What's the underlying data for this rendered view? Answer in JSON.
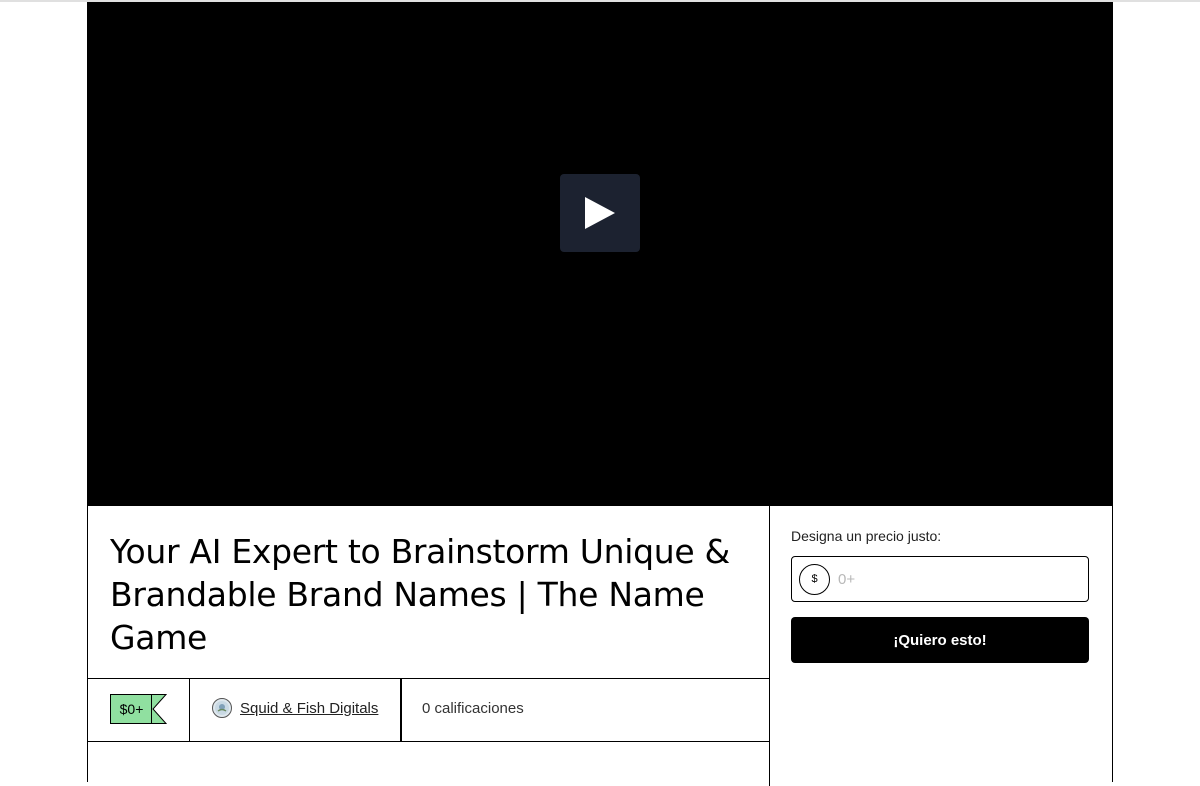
{
  "product": {
    "title": "Your AI Expert to Brainstorm Unique & Brandable Brand Names | The Name Game",
    "price_tag": "$0+",
    "seller_name": "Squid & Fish Digitals",
    "ratings_text": "0 calificaciones"
  },
  "video": {
    "play_icon": "play-icon"
  },
  "purchase": {
    "price_label": "Designa un precio justo:",
    "currency_symbol": "$",
    "price_placeholder": "0+",
    "price_value": "",
    "buy_button_label": "¡Quiero esto!"
  },
  "colors": {
    "price_tag_bg": "#90e0a0",
    "play_button_bg": "#1c2230",
    "buy_button_bg": "#000000"
  }
}
